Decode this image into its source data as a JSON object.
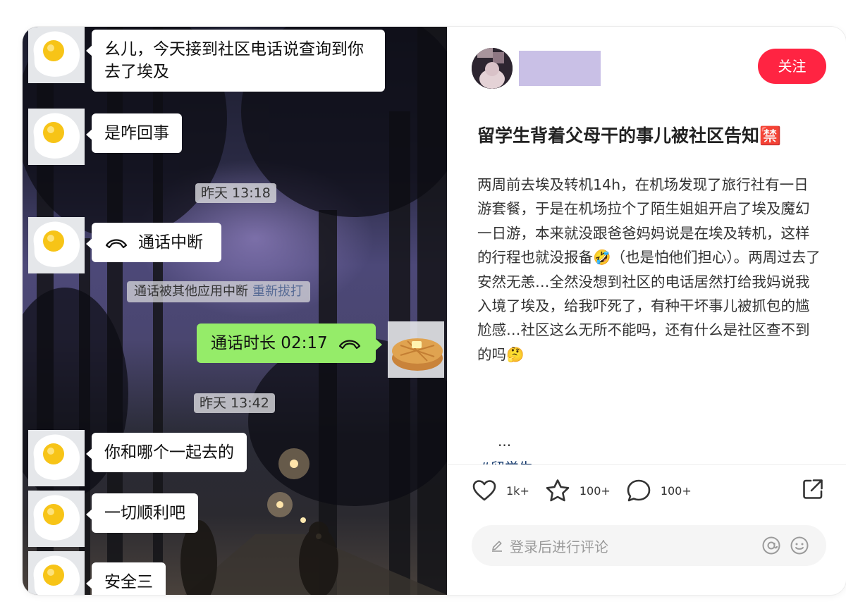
{
  "chat": {
    "msg1": "幺儿，今天接到社区电话说查询到你去了埃及",
    "msg2": "是咋回事",
    "time1": "昨天 13:18",
    "call_interrupted": "通话中断",
    "sys_notice": "通话被其他应用中断",
    "redial": "重新拔打",
    "call_duration": "通话时长 02:17",
    "time2": "昨天 13:42",
    "msg3": "你和哪个一起去的",
    "msg4": "一切顺利吧",
    "msg5": "安全三"
  },
  "post": {
    "follow_label": "关注",
    "title": "留学生背着父母干的事儿被社区告知🈲",
    "body": "两周前去埃及转机14h，在机场发现了旅行社有一日游套餐，于是在机场拉个了陌生姐姐开启了埃及魔幻一日游，本来就没跟爸爸妈妈说是在埃及转机，这样的行程也就没报备🤣（也是怕他们担心）。两周过去了安然无恙…全然没想到社区的电话居然打给我妈说我入境了埃及，给我吓死了，有种干坏事儿被抓包的尴尬感…社区这么无所不能吗，还有什么是社区查不到的吗🤔",
    "ellipsis": "...",
    "tag": "#留学生"
  },
  "actions": {
    "likes": "1k+",
    "collects": "100+",
    "comments": "100+"
  },
  "comment": {
    "placeholder": "登录后进行评论"
  },
  "colors": {
    "follow": "#ff2442",
    "sent_bubble": "#95ec69",
    "redial_link": "#576b95",
    "tag": "#13386c"
  },
  "icons": [
    "heart-icon",
    "star-icon",
    "comment-icon",
    "share-icon",
    "pen-icon",
    "at-icon",
    "emoji-icon",
    "phone-hangup-icon"
  ]
}
